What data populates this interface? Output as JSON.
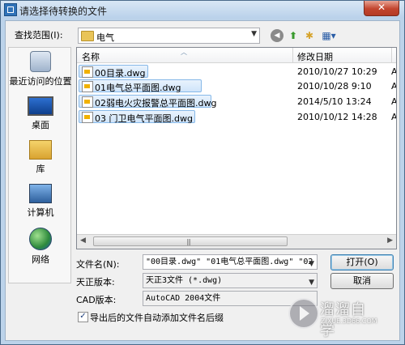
{
  "window": {
    "title": "请选择待转换的文件",
    "close_glyph": "✕"
  },
  "lookin": {
    "label": "查找范围(I):",
    "value": "电气"
  },
  "toolbar": [
    "back-icon",
    "up-folder-icon",
    "new-folder-icon",
    "view-menu-icon"
  ],
  "places": [
    {
      "label": "最近访问的位置",
      "icon": "recent-places-icon"
    },
    {
      "label": "桌面",
      "icon": "desktop-icon"
    },
    {
      "label": "库",
      "icon": "libraries-icon"
    },
    {
      "label": "计算机",
      "icon": "computer-icon"
    },
    {
      "label": "网络",
      "icon": "network-icon"
    }
  ],
  "filelist": {
    "columns": [
      "名称",
      "修改日期"
    ],
    "files": [
      {
        "name": "00目录.dwg",
        "date": "2010/10/27 10:29",
        "more": "A"
      },
      {
        "name": "01电气总平面图.dwg",
        "date": "2010/10/28 9:10",
        "more": "A"
      },
      {
        "name": "02弱电火灾报警总平面图.dwg",
        "date": "2014/5/10 13:24",
        "more": "A"
      },
      {
        "name": "03 门卫电气平面图.dwg",
        "date": "2010/10/12 14:28",
        "more": "A"
      }
    ]
  },
  "form": {
    "filename_label": "文件名(N):",
    "filename_value": "\"00目录.dwg\" \"01电气总平面图.dwg\" \"02",
    "version_label": "天正版本:",
    "version_value": "天正3文件 (*.dwg)",
    "cad_label": "CAD版本:",
    "cad_value": "AutoCAD 2004文件"
  },
  "buttons": {
    "open": "打开(O)",
    "cancel": "取消"
  },
  "checkbox": {
    "label": "导出后的文件自动添加文件名后缀",
    "checked": true,
    "mark": "✓"
  },
  "watermark": {
    "name": "溜溜自学",
    "url": "ZIXUE.3D66.COM"
  }
}
